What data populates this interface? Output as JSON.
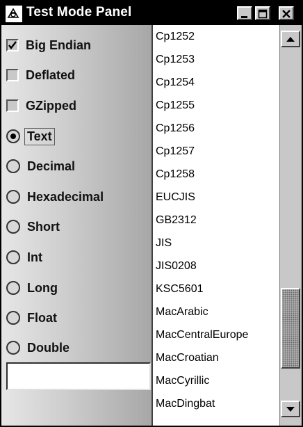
{
  "window": {
    "title": "Test Mode Panel"
  },
  "options": [
    {
      "label": "Big Endian",
      "kind": "checkbox",
      "checked": true
    },
    {
      "label": "Deflated",
      "kind": "checkbox",
      "checked": false
    },
    {
      "label": "GZipped",
      "kind": "checkbox",
      "checked": false
    },
    {
      "label": "Text",
      "kind": "radio",
      "checked": true
    },
    {
      "label": "Decimal",
      "kind": "radio",
      "checked": false
    },
    {
      "label": "Hexadecimal",
      "kind": "radio",
      "checked": false
    },
    {
      "label": "Short",
      "kind": "radio",
      "checked": false
    },
    {
      "label": "Int",
      "kind": "radio",
      "checked": false
    },
    {
      "label": "Long",
      "kind": "radio",
      "checked": false
    },
    {
      "label": "Float",
      "kind": "radio",
      "checked": false
    },
    {
      "label": "Double",
      "kind": "radio",
      "checked": false
    }
  ],
  "textfield": {
    "value": ""
  },
  "encodings": [
    "Cp1252",
    "Cp1253",
    "Cp1254",
    "Cp1255",
    "Cp1256",
    "Cp1257",
    "Cp1258",
    "EUCJIS",
    "GB2312",
    "JIS",
    "JIS0208",
    "KSC5601",
    "MacArabic",
    "MacCentralEurope",
    "MacCroatian",
    "MacCyrillic",
    "MacDingbat"
  ]
}
